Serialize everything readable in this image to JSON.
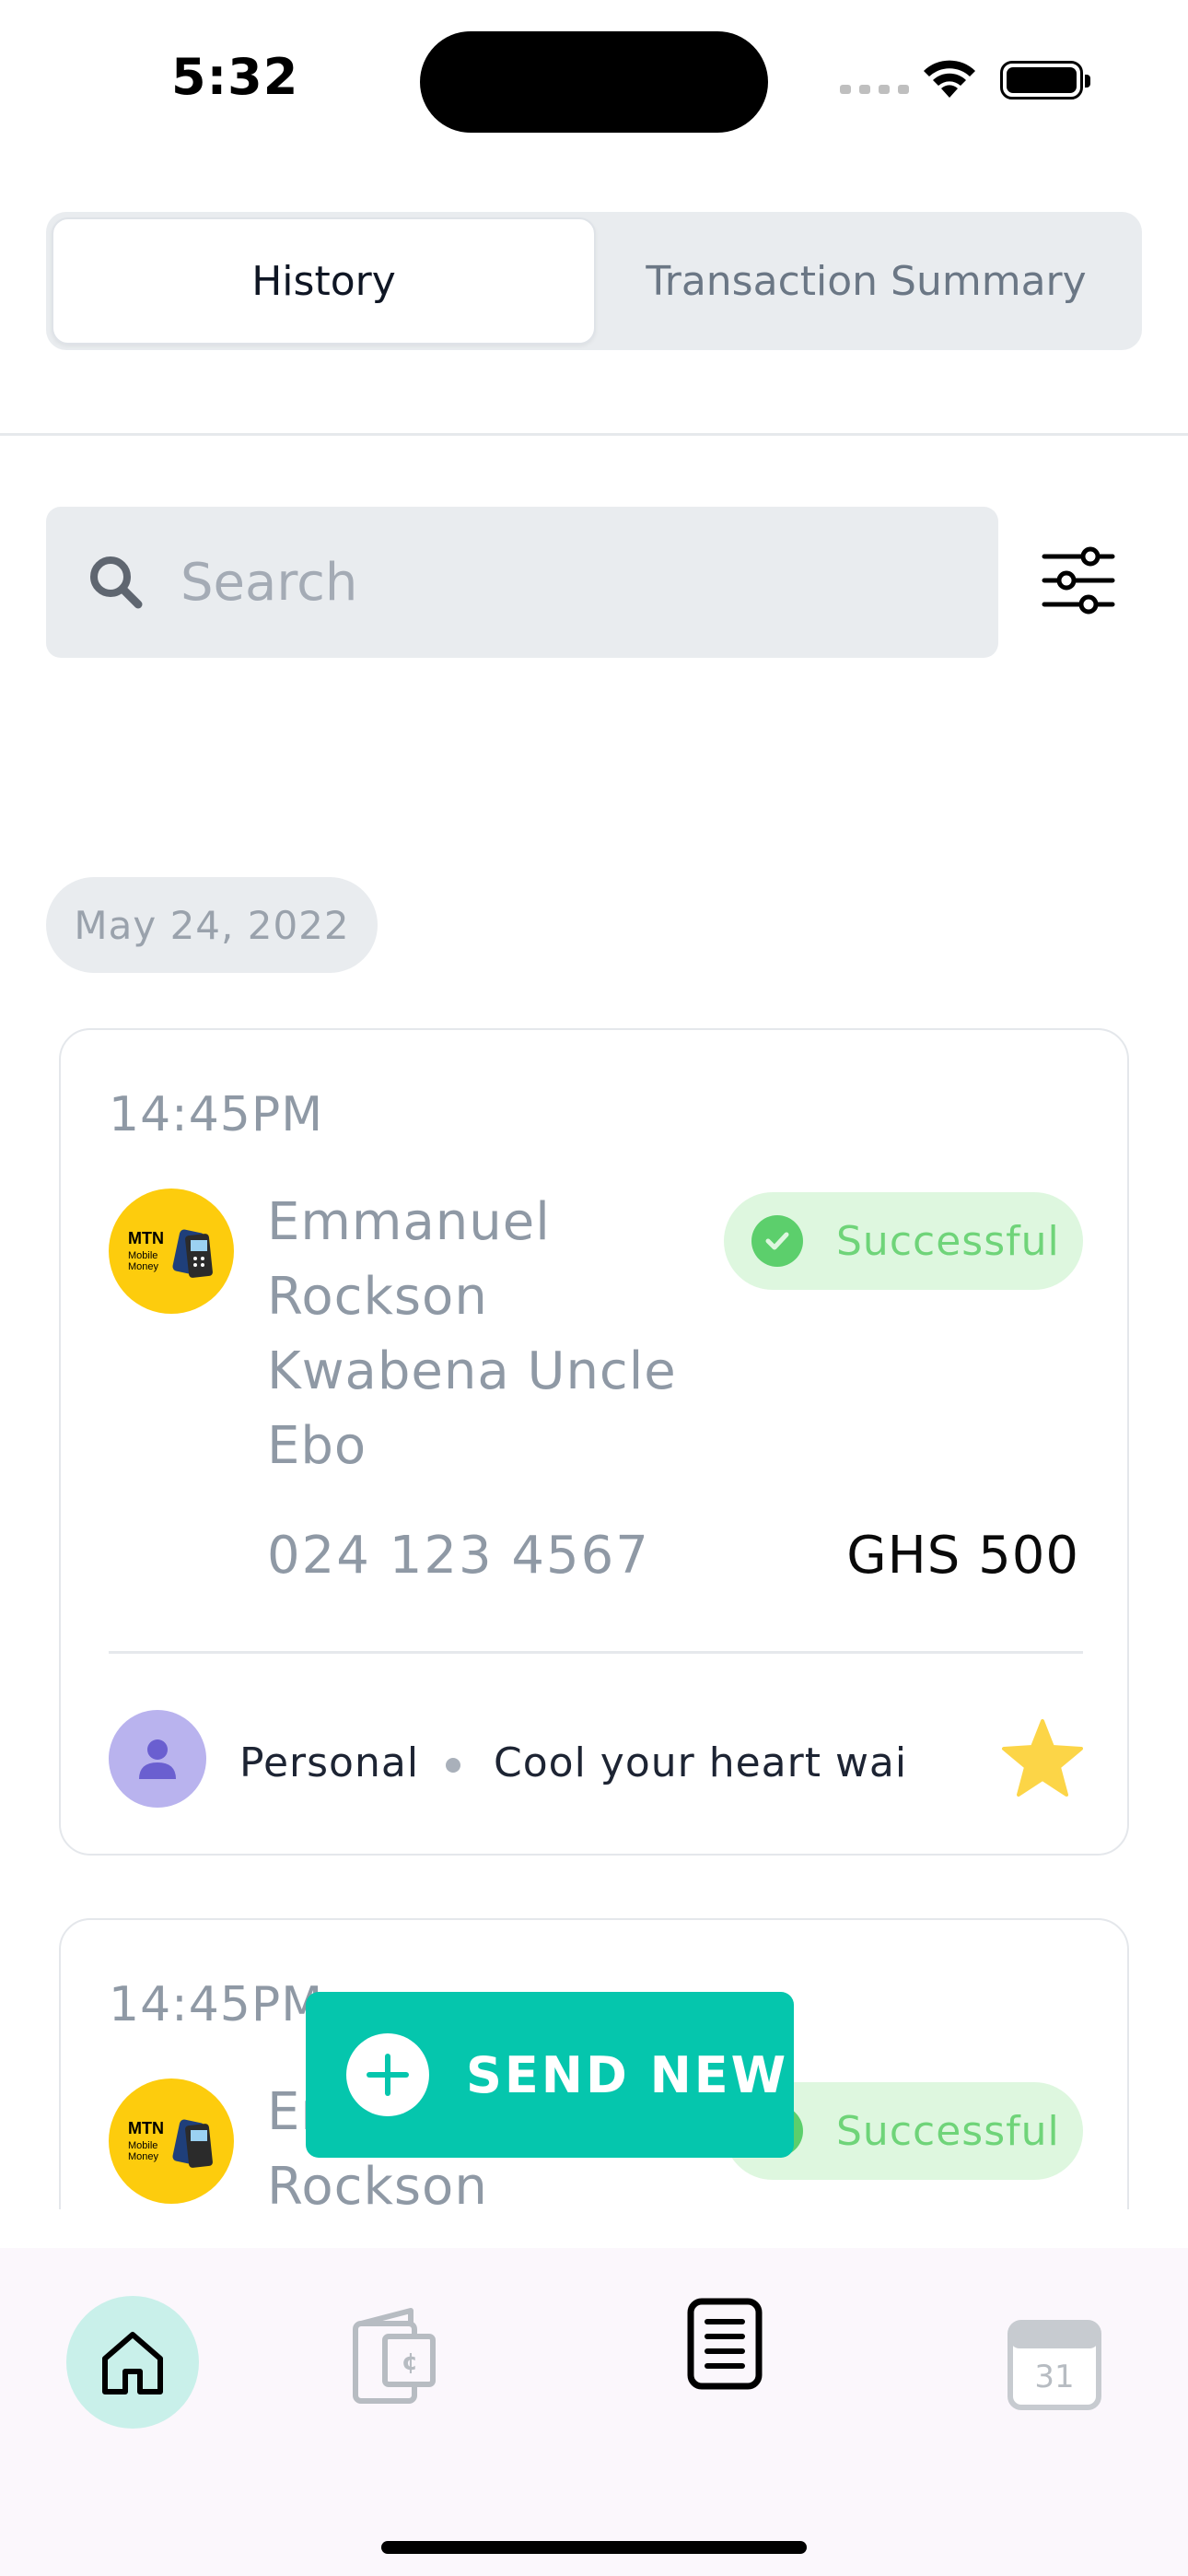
{
  "status_bar": {
    "time": "5:32"
  },
  "tabs": {
    "history": "History",
    "summary": "Transaction Summary",
    "active": "History"
  },
  "search": {
    "placeholder": "Search"
  },
  "date_group": "May 24, 2022",
  "transactions": [
    {
      "time": "14:45PM",
      "provider_logo": "MTN Mobile Money",
      "name": "Emmanuel Rockson Kwabena Uncle Ebo",
      "status": "Successful",
      "phone": "024 123 4567",
      "amount": "GHS 500",
      "category": "Personal",
      "note": "Cool your heart wai",
      "favorite": true
    },
    {
      "time": "14:45PM",
      "provider_logo": "MTN Mobile Money",
      "name": "Emmanuel Rockson",
      "status": "Successful"
    }
  ],
  "fab": {
    "label": "SEND NEW"
  },
  "bottom_nav": [
    {
      "icon": "home-icon",
      "active": true
    },
    {
      "icon": "wallet-icon",
      "active": false
    },
    {
      "icon": "receipt-icon",
      "active": false
    },
    {
      "icon": "calendar-icon",
      "label": "31",
      "active": false
    }
  ],
  "colors": {
    "accent": "#05c6ad",
    "success_bg": "#def7df",
    "success_text": "#6fd479",
    "mtn_yellow": "#fdcc0d",
    "avatar_purple": "#b9b3ee",
    "star": "#fcd547"
  }
}
